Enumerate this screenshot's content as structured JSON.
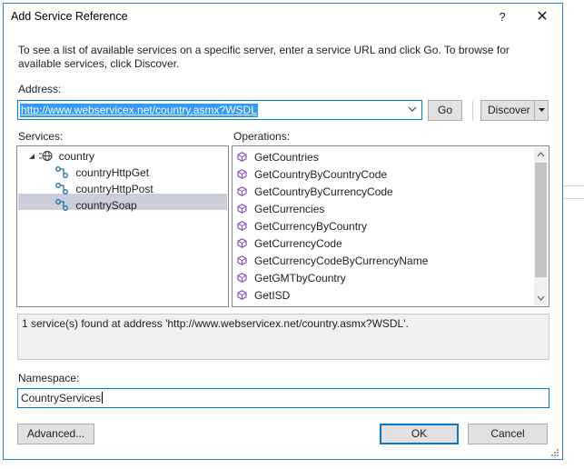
{
  "window": {
    "title": "Add Service Reference",
    "help_glyph": "?",
    "close_glyph": "✕"
  },
  "instructions": "To see a list of available services on a specific server, enter a service URL and click Go. To browse for available services, click Discover.",
  "address": {
    "label": "Address:",
    "value": "http://www.webservicex.net/country.asmx?WSDL",
    "go_label": "Go",
    "discover_label": "Discover"
  },
  "services": {
    "label": "Services:",
    "root": {
      "label": "country",
      "expander": "◢"
    },
    "items": [
      {
        "label": "countryHttpGet"
      },
      {
        "label": "countryHttpPost"
      },
      {
        "label": "countrySoap",
        "selected": true
      }
    ]
  },
  "operations": {
    "label": "Operations:",
    "items": [
      "GetCountries",
      "GetCountryByCountryCode",
      "GetCountryByCurrencyCode",
      "GetCurrencies",
      "GetCurrencyByCountry",
      "GetCurrencyCode",
      "GetCurrencyCodeByCurrencyName",
      "GetGMTbyCountry",
      "GetISD"
    ]
  },
  "status_message": "1 service(s) found at address 'http://www.webservicex.net/country.asmx?WSDL'.",
  "namespace": {
    "label": "Namespace:",
    "value": "CountryServices"
  },
  "buttons": {
    "advanced": "Advanced...",
    "ok": "OK",
    "cancel": "Cancel"
  },
  "colors": {
    "accent": "#0078d7",
    "selection": "#3399ff",
    "tree_selection": "#cccedb",
    "op_icon": "#8a4fbf",
    "service_icon": "#1c6ea4"
  }
}
